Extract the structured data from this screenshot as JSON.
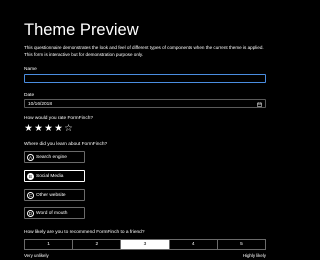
{
  "page": {
    "title": "Theme Preview",
    "description_line1": "This questionnaire demonstrates the look and feel of different types of components when the current theme is applied.",
    "description_line2": "This form is interactive but for demonstration purpose only."
  },
  "name_field": {
    "label": "Name",
    "value": "",
    "placeholder": ""
  },
  "date_field": {
    "label": "Date",
    "value": "10/16/2018",
    "icon": "calendar-icon"
  },
  "rating": {
    "label": "How would you rate FormFinch?",
    "max": 5,
    "value": 4,
    "stars": [
      {
        "symbol": "★"
      },
      {
        "symbol": "★"
      },
      {
        "symbol": "★"
      },
      {
        "symbol": "★"
      },
      {
        "symbol": "☆"
      }
    ]
  },
  "source": {
    "label": "Where did you learn about FormFinch?",
    "selected": "B",
    "options": [
      {
        "key": "A",
        "label": "Search engine"
      },
      {
        "key": "B",
        "label": "Social Media"
      },
      {
        "key": "C",
        "label": "Other website"
      },
      {
        "key": "D",
        "label": "Word of mouth"
      }
    ]
  },
  "recommend": {
    "label": "How likely are you to recommend FormFinch to a friend?",
    "options": [
      "1",
      "2",
      "3",
      "4",
      "5"
    ],
    "selected": "3",
    "min_label": "Very unlikely",
    "max_label": "Highly likely"
  }
}
